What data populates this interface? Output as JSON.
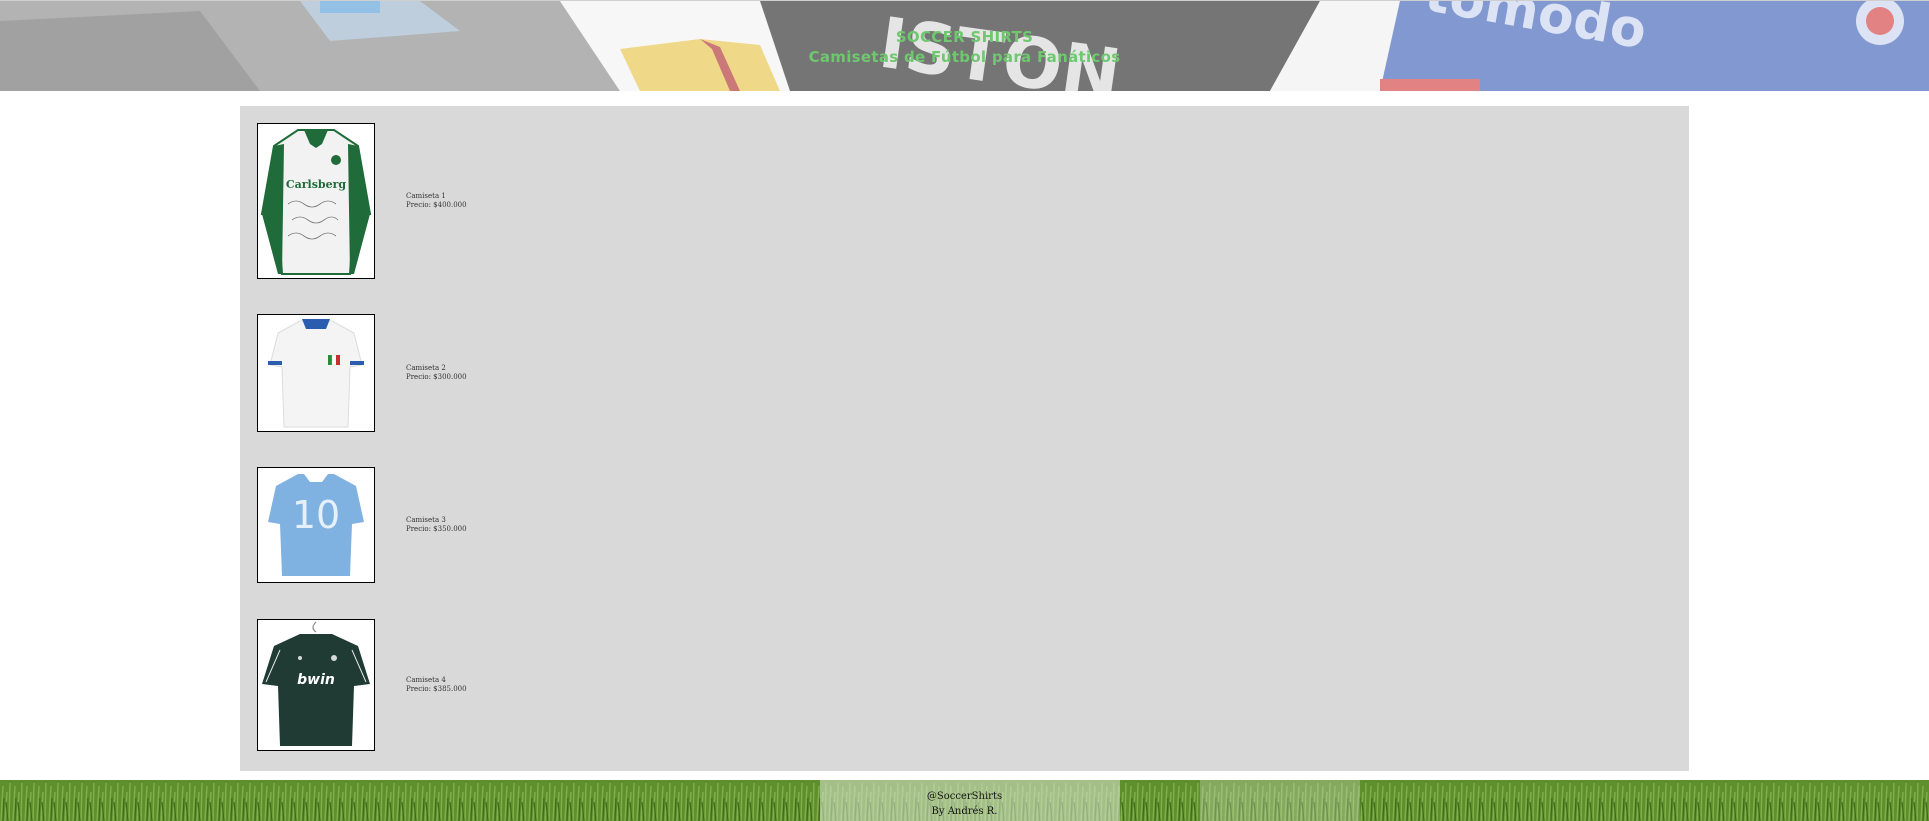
{
  "header": {
    "title": "SOCCER SHIRTS",
    "subtitle": "Camisetas de Fútbol para Fanáticos"
  },
  "products": [
    {
      "name": "Camiseta 1",
      "price": "Precio: $400.000",
      "image": "signed-white-green-shirt"
    },
    {
      "name": "Camiseta 2",
      "price": "Precio: $300.000",
      "image": "white-italy-polo-shirt"
    },
    {
      "name": "Camiseta 3",
      "price": "Precio: $350.000",
      "image": "sky-blue-number-10-shirt"
    },
    {
      "name": "Camiseta 4",
      "price": "Precio: $385.000",
      "image": "dark-green-bwin-shirt"
    }
  ],
  "footer": {
    "handle": "@SoccerShirts",
    "author": "By Andrés R."
  },
  "colors": {
    "header_text": "#6ec86e",
    "panel_bg": "#d9d9d9",
    "footer_grass": "#5f8f2d"
  }
}
